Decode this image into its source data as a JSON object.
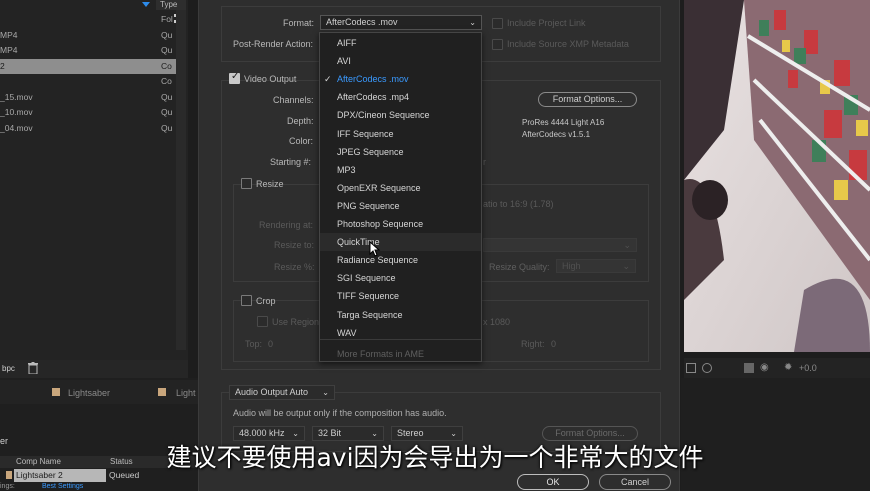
{
  "project_panel": {
    "type_header": "Type",
    "rows": [
      {
        "name": "",
        "type": "Fol",
        "selected": false
      },
      {
        "name": "MP4",
        "type": "Qu",
        "selected": false
      },
      {
        "name": "MP4",
        "type": "Qu",
        "selected": false
      },
      {
        "name": "2",
        "type": "Co",
        "selected": true
      },
      {
        "name": "",
        "type": "Co",
        "selected": false
      },
      {
        "name": "_15.mov",
        "type": "Qu",
        "selected": false
      },
      {
        "name": "_10.mov",
        "type": "Qu",
        "selected": false
      },
      {
        "name": "_04.mov",
        "type": "Qu",
        "selected": false
      }
    ],
    "bpc": "bpc"
  },
  "timeline_tabs": [
    "Lightsaber",
    "Light"
  ],
  "render_queue": {
    "panel_label": "er",
    "col_comp_name": "Comp Name",
    "col_status": "Status",
    "comp_name": "Lightsaber 2",
    "status": "Queued",
    "settings_prefix": "ings:",
    "settings_value": "Best Settings"
  },
  "dialog": {
    "format_label": "Format:",
    "format_value": "AfterCodecs .mov",
    "post_render_label": "Post-Render Action:",
    "include_project_link": "Include Project Link",
    "include_xmp": "Include Source XMP Metadata",
    "video_output_label": "Video Output",
    "video_output_checked": true,
    "channels_label": "Channels:",
    "depth_label": "Depth:",
    "color_label": "Color:",
    "starting_label": "Starting #:",
    "format_options_button": "Format Options...",
    "codec_line1": "ProRes 4444 Light A16",
    "codec_line2": "AfterCodecs v1.5.1",
    "starting_suffix": "r",
    "resize_label": "Resize",
    "rendering_at_label": "Rendering at:",
    "resize_to_label": "Resize to:",
    "resize_pct_label": "Resize %:",
    "ratio_text": "atio to 16:9 (1.78)",
    "resize_quality_label": "Resize Quality:",
    "resize_quality_value": "High",
    "crop_label": "Crop",
    "use_region_label": "Use Region",
    "region_size": "x 1080",
    "top_label": "Top:",
    "top_value": "0",
    "right_label": "Right:",
    "right_value": "0",
    "audio_output_value": "Audio Output Auto",
    "audio_note": "Audio will be output only if the composition has audio.",
    "sample_rate": "48.000 kHz",
    "bit_depth": "32 Bit",
    "channels_audio": "Stereo",
    "audio_format_options": "Format Options...",
    "ok_button": "OK",
    "cancel_button": "Cancel"
  },
  "format_menu": {
    "items": [
      {
        "label": "AIFF",
        "checked": false,
        "hover": false,
        "disabled": false
      },
      {
        "label": "AVI",
        "checked": false,
        "hover": false,
        "disabled": false
      },
      {
        "label": "AfterCodecs .mov",
        "checked": true,
        "hover": false,
        "disabled": false
      },
      {
        "label": "AfterCodecs .mp4",
        "checked": false,
        "hover": false,
        "disabled": false
      },
      {
        "label": "DPX/Cineon Sequence",
        "checked": false,
        "hover": false,
        "disabled": false
      },
      {
        "label": "IFF Sequence",
        "checked": false,
        "hover": false,
        "disabled": false
      },
      {
        "label": "JPEG Sequence",
        "checked": false,
        "hover": false,
        "disabled": false
      },
      {
        "label": "MP3",
        "checked": false,
        "hover": false,
        "disabled": false
      },
      {
        "label": "OpenEXR Sequence",
        "checked": false,
        "hover": false,
        "disabled": false
      },
      {
        "label": "PNG Sequence",
        "checked": false,
        "hover": false,
        "disabled": false
      },
      {
        "label": "Photoshop Sequence",
        "checked": false,
        "hover": false,
        "disabled": false
      },
      {
        "label": "QuickTime",
        "checked": false,
        "hover": true,
        "disabled": false
      },
      {
        "label": "Radiance Sequence",
        "checked": false,
        "hover": false,
        "disabled": false
      },
      {
        "label": "SGI Sequence",
        "checked": false,
        "hover": false,
        "disabled": false
      },
      {
        "label": "TIFF Sequence",
        "checked": false,
        "hover": false,
        "disabled": false
      },
      {
        "label": "Targa Sequence",
        "checked": false,
        "hover": false,
        "disabled": false
      },
      {
        "label": "WAV",
        "checked": false,
        "hover": false,
        "disabled": false
      },
      {
        "label": "More Formats in AME",
        "checked": false,
        "hover": false,
        "disabled": true
      }
    ],
    "check_glyph": "✓"
  },
  "viewer": {
    "exposure": "+0.0"
  },
  "subtitle": "建议不要使用avi因为会导出为一个非常大的文件",
  "colors": {
    "accent_blue": "#3a9aff",
    "dialog_bg": "#2e2e2e",
    "menu_bg": "#202020"
  }
}
